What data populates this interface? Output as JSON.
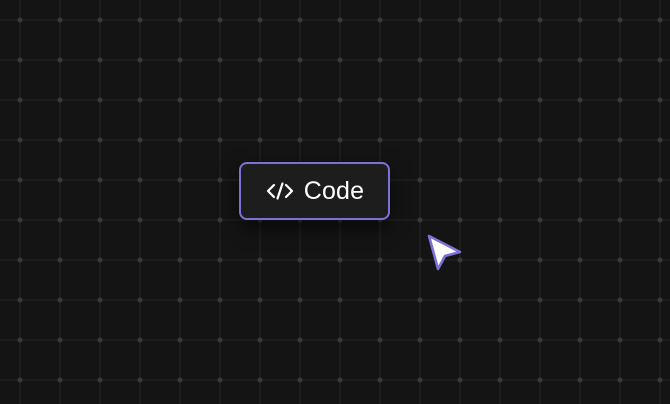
{
  "canvas": {
    "background": "#141414",
    "grid_color": "#262626",
    "dot_color": "#3a3a3a"
  },
  "chip": {
    "icon": "code-brackets-icon",
    "label": "Code",
    "border_color": "#7b72d6"
  },
  "cursor": {
    "icon": "pointer-arrow-icon",
    "fill": "#ffffff",
    "stroke": "#7b72d6"
  }
}
